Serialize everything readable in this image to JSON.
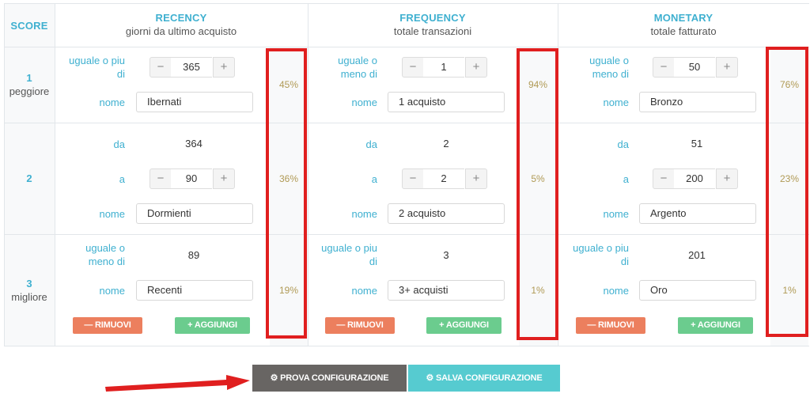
{
  "header": {
    "score_label": "SCORE",
    "recency": {
      "title": "RECENCY",
      "subtitle": "giorni da ultimo acquisto"
    },
    "frequency": {
      "title": "FREQUENCY",
      "subtitle": "totale transazioni"
    },
    "monetary": {
      "title": "MONETARY",
      "subtitle": "totale fatturato"
    }
  },
  "rows": [
    {
      "score": "1",
      "score_label": "peggiore"
    },
    {
      "score": "2",
      "score_label": ""
    },
    {
      "score": "3",
      "score_label": "migliore"
    }
  ],
  "recency": {
    "r1": {
      "cond": "uguale o piu di",
      "value": "365",
      "name_label": "nome",
      "name": "Ibernati",
      "pct": "45%"
    },
    "r2": {
      "from_label": "da",
      "from": "364",
      "to_label": "a",
      "to": "90",
      "name_label": "nome",
      "name": "Dormienti",
      "pct": "36%"
    },
    "r3": {
      "cond": "uguale o meno di",
      "value": "89",
      "name_label": "nome",
      "name": "Recenti",
      "pct": "19%"
    }
  },
  "frequency": {
    "r1": {
      "cond": "uguale o meno di",
      "value": "1",
      "name_label": "nome",
      "name": "1 acquisto",
      "pct": "94%"
    },
    "r2": {
      "from_label": "da",
      "from": "2",
      "to_label": "a",
      "to": "2",
      "name_label": "nome",
      "name": "2 acquisto",
      "pct": "5%"
    },
    "r3": {
      "cond": "uguale o piu di",
      "value": "3",
      "name_label": "nome",
      "name": "3+ acquisti",
      "pct": "1%"
    }
  },
  "monetary": {
    "r1": {
      "cond": "uguale o meno di",
      "value": "50",
      "name_label": "nome",
      "name": "Bronzo",
      "pct": "76%"
    },
    "r2": {
      "from_label": "da",
      "from": "51",
      "to_label": "a",
      "to": "200",
      "name_label": "nome",
      "name": "Argento",
      "pct": "23%"
    },
    "r3": {
      "cond": "uguale o piu di",
      "value": "201",
      "name_label": "nome",
      "name": "Oro",
      "pct": "1%"
    }
  },
  "buttons": {
    "remove": "RIMUOVI",
    "add": "AGGIUNGI",
    "test_config": "PROVA CONFIGURAZIONE",
    "save_config": "SALVA CONFIGURAZIONE"
  },
  "stepper": {
    "minus": "−",
    "plus": "+"
  },
  "icons": {
    "remove": "minus-icon",
    "add": "plus-icon",
    "gear": "gear-icon"
  },
  "colors": {
    "accent": "#3fb0d0",
    "percent": "#b09a55",
    "remove_button": "#ec7f5e",
    "add_button": "#6bcc8e",
    "test_button": "#686563",
    "save_button": "#56cbd0",
    "highlight": "#e01f1f"
  }
}
